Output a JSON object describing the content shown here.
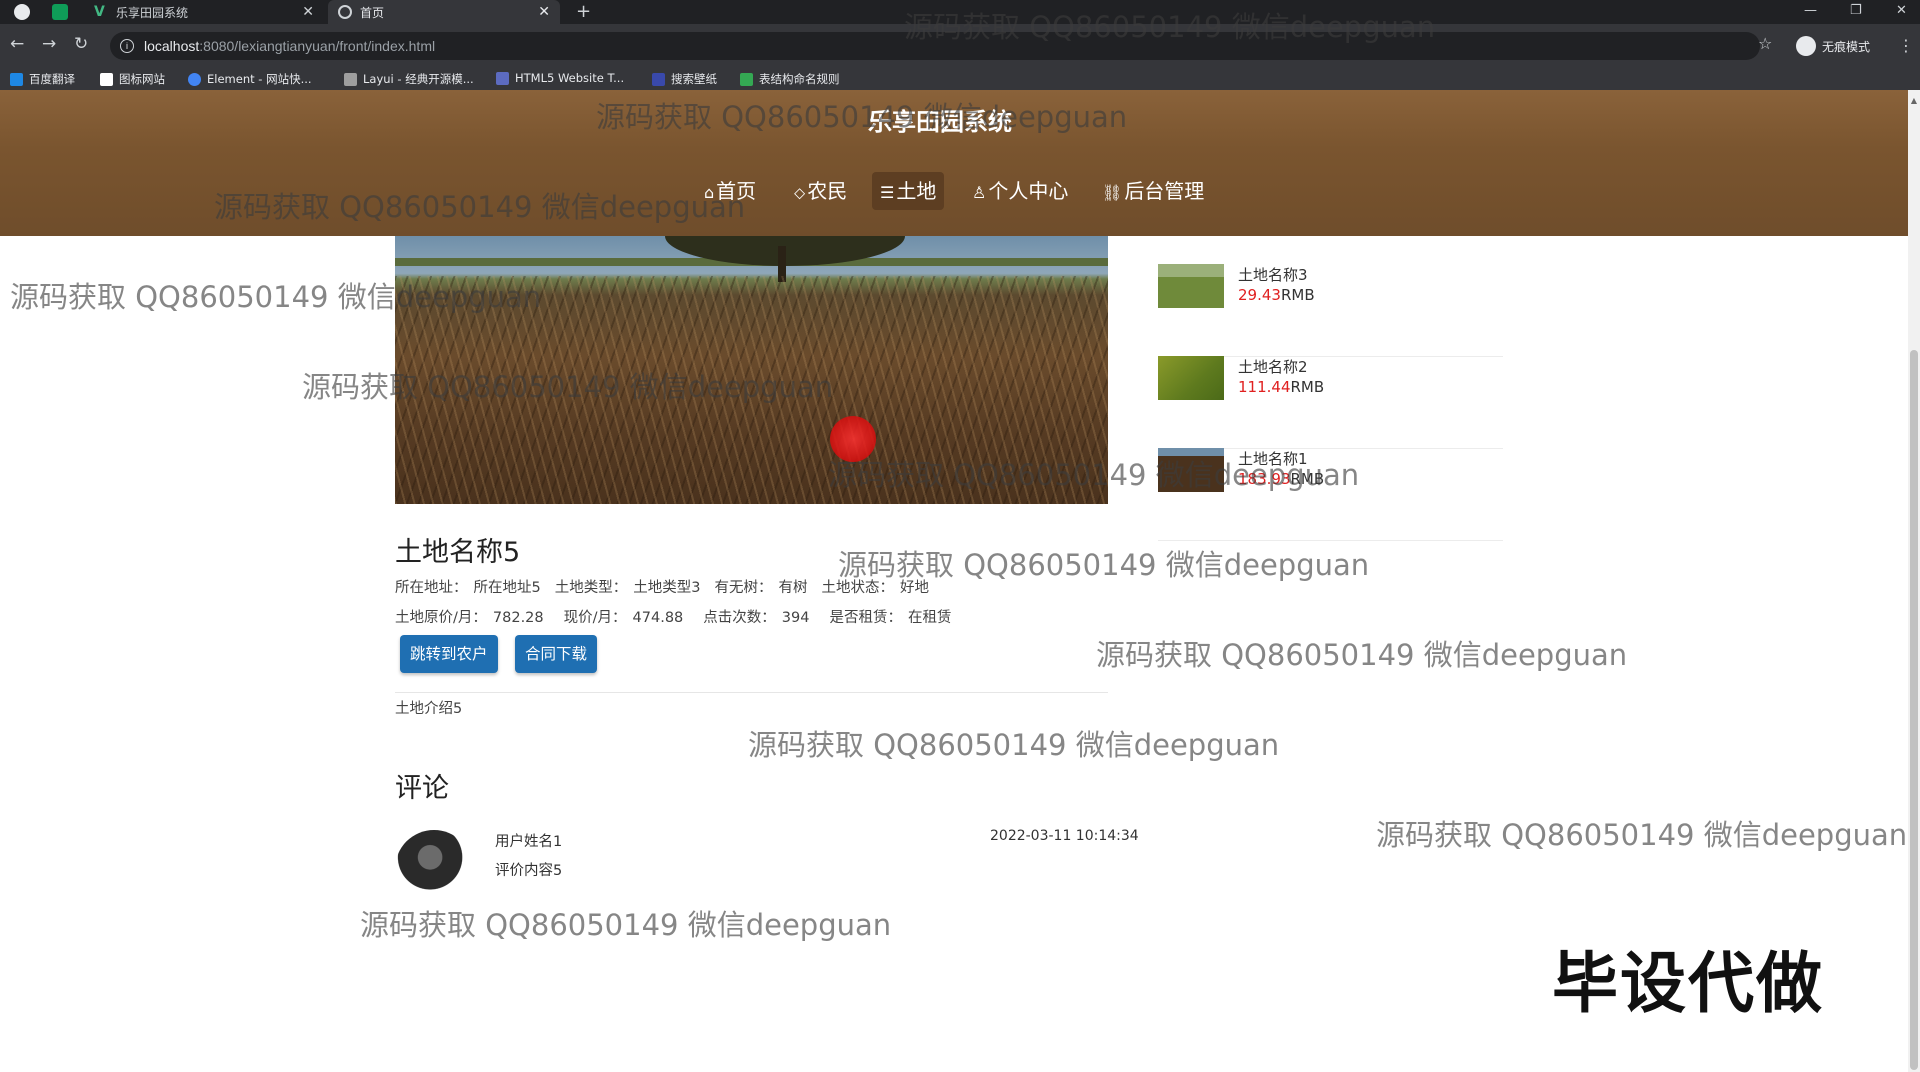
{
  "browser": {
    "tabs": [
      {
        "title": "乐享田园系统"
      },
      {
        "title": "首页"
      }
    ],
    "url_host": "localhost",
    "url_path": ":8080/lexiangtianyuan/front/index.html",
    "profile_label": "无痕模式",
    "bookmarks": [
      "百度翻译",
      "图标网站",
      "Element - 网站快...",
      "Layui - 经典开源模...",
      "HTML5 Website T...",
      "搜索壁纸",
      "表结构命名规则"
    ],
    "bookmark_colors": [
      "#1e88e5",
      "#ffffff",
      "#4285f4",
      "#9e9e9e",
      "#5c6bc0",
      "#3949ab",
      "#34a853"
    ]
  },
  "site": {
    "title": "乐享田园系统",
    "nav": [
      {
        "label": "首页",
        "icon": "home-icon",
        "glyph": "⌂"
      },
      {
        "label": "农民",
        "icon": "tag-icon",
        "glyph": "⬦"
      },
      {
        "label": "土地",
        "icon": "layers-icon",
        "glyph": "☰"
      },
      {
        "label": "个人中心",
        "icon": "user-icon",
        "glyph": "♙"
      },
      {
        "label": "后台管理",
        "icon": "link-icon",
        "glyph": "⛓"
      }
    ],
    "active_nav": "土地"
  },
  "detail": {
    "title": "土地名称5",
    "row1": {
      "address_label": "所在地址：",
      "address": "所在地址5",
      "type_label": "土地类型：",
      "type": "土地类型3",
      "trees_label": "有无树：",
      "trees": "有树",
      "status_label": "土地状态：",
      "status": "好地"
    },
    "row2": {
      "orig_price_label": "土地原价/月：",
      "orig_price": "782.28",
      "cur_price_label": "现价/月：",
      "cur_price": "474.88",
      "clicks_label": "点击次数：",
      "clicks": "394",
      "rented_label": "是否租赁：",
      "rented": "在租赁"
    },
    "buttons": {
      "farmer": "跳转到农户",
      "contract": "合同下载"
    },
    "intro": "土地介绍5"
  },
  "comments": {
    "title": "评论",
    "items": [
      {
        "user": "用户姓名1",
        "content": "评价内容5",
        "time": "2022-03-11 10:14:34"
      }
    ]
  },
  "side_list": [
    {
      "name": "土地名称3",
      "price": "29.43",
      "unit": "RMB"
    },
    {
      "name": "土地名称2",
      "price": "111.44",
      "unit": "RMB"
    },
    {
      "name": "土地名称1",
      "price": "183.93",
      "unit": "RMB"
    }
  ],
  "watermark": "源码获取 QQ86050149 微信deepguan",
  "promo": "毕设代做",
  "colors": {
    "header": "#7a552f",
    "accent_button": "#1f6fb2",
    "price_red": "#e02020"
  }
}
